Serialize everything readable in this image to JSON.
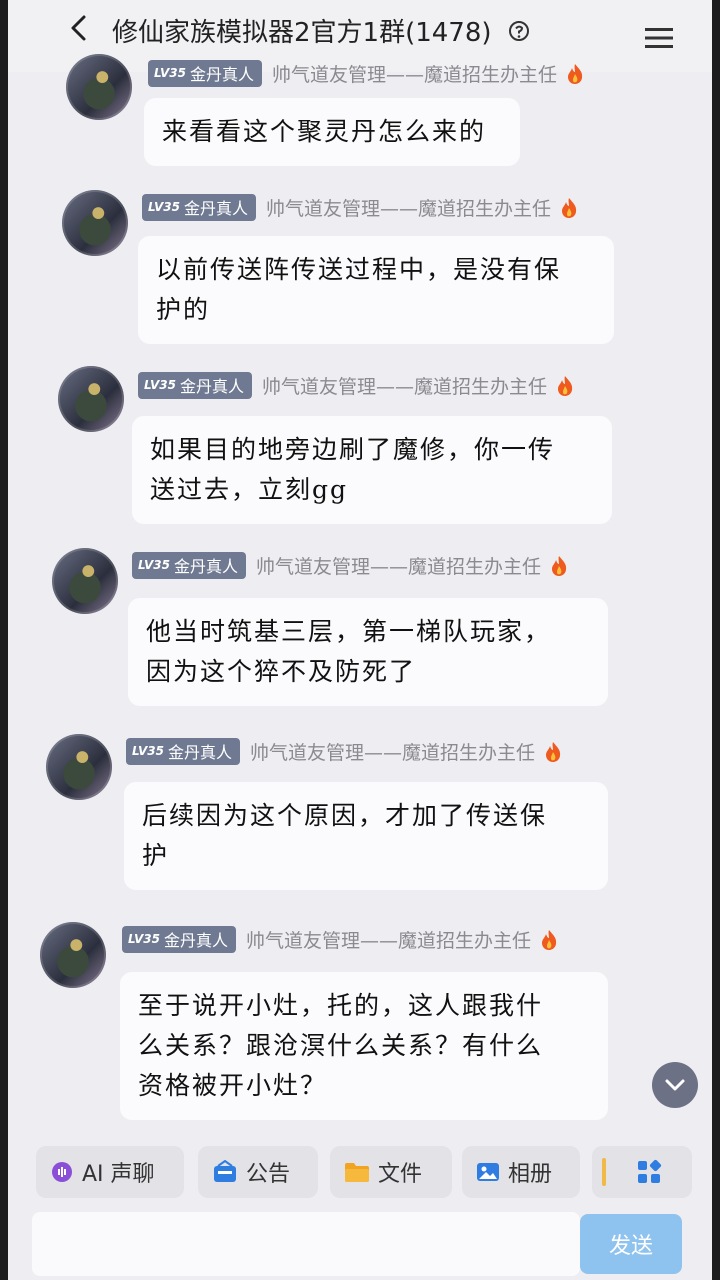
{
  "header": {
    "title": "修仙家族模拟器2官方1群(1478)"
  },
  "messages": [
    {
      "badge_level": "LV35",
      "badge_title": "金丹真人",
      "role": "帅气道友管理——魔道招生办主任",
      "lines": [
        "来看看这个聚灵丹怎么来的"
      ]
    },
    {
      "badge_level": "LV35",
      "badge_title": "金丹真人",
      "role": "帅气道友管理——魔道招生办主任",
      "lines": [
        "以前传送阵传送过程中，是没有保",
        "护的"
      ]
    },
    {
      "badge_level": "LV35",
      "badge_title": "金丹真人",
      "role": "帅气道友管理——魔道招生办主任",
      "lines": [
        "如果目的地旁边刷了魔修，你一传",
        "送过去，立刻gg"
      ]
    },
    {
      "badge_level": "LV35",
      "badge_title": "金丹真人",
      "role": "帅气道友管理——魔道招生办主任",
      "lines": [
        "他当时筑基三层，第一梯队玩家，",
        "因为这个猝不及防死了"
      ]
    },
    {
      "badge_level": "LV35",
      "badge_title": "金丹真人",
      "role": "帅气道友管理——魔道招生办主任",
      "lines": [
        "后续因为这个原因，才加了传送保",
        "护"
      ]
    },
    {
      "badge_level": "LV35",
      "badge_title": "金丹真人",
      "role": "帅气道友管理——魔道招生办主任",
      "lines": [
        "至于说开小灶，托的，这人跟我什",
        "么关系？跟沧溟什么关系？有什么",
        "资格被开小灶？"
      ]
    }
  ],
  "toolbar": {
    "items": [
      {
        "label": "AI 声聊",
        "icon": "ai-voice-icon",
        "color": "#8a4fd6"
      },
      {
        "label": "公告",
        "icon": "announcement-icon",
        "color": "#2f7de1"
      },
      {
        "label": "文件",
        "icon": "folder-icon",
        "color": "#f0a422"
      },
      {
        "label": "相册",
        "icon": "album-icon",
        "color": "#2f7de1"
      }
    ]
  },
  "send_label": "发送",
  "colors": {
    "background": "#eeeef2",
    "bubble": "#fbfbfd",
    "badge": "#6f7a92",
    "role_text": "#8a8a90",
    "send_button": "#8fc3ef",
    "fire": "#ef5a1e"
  }
}
